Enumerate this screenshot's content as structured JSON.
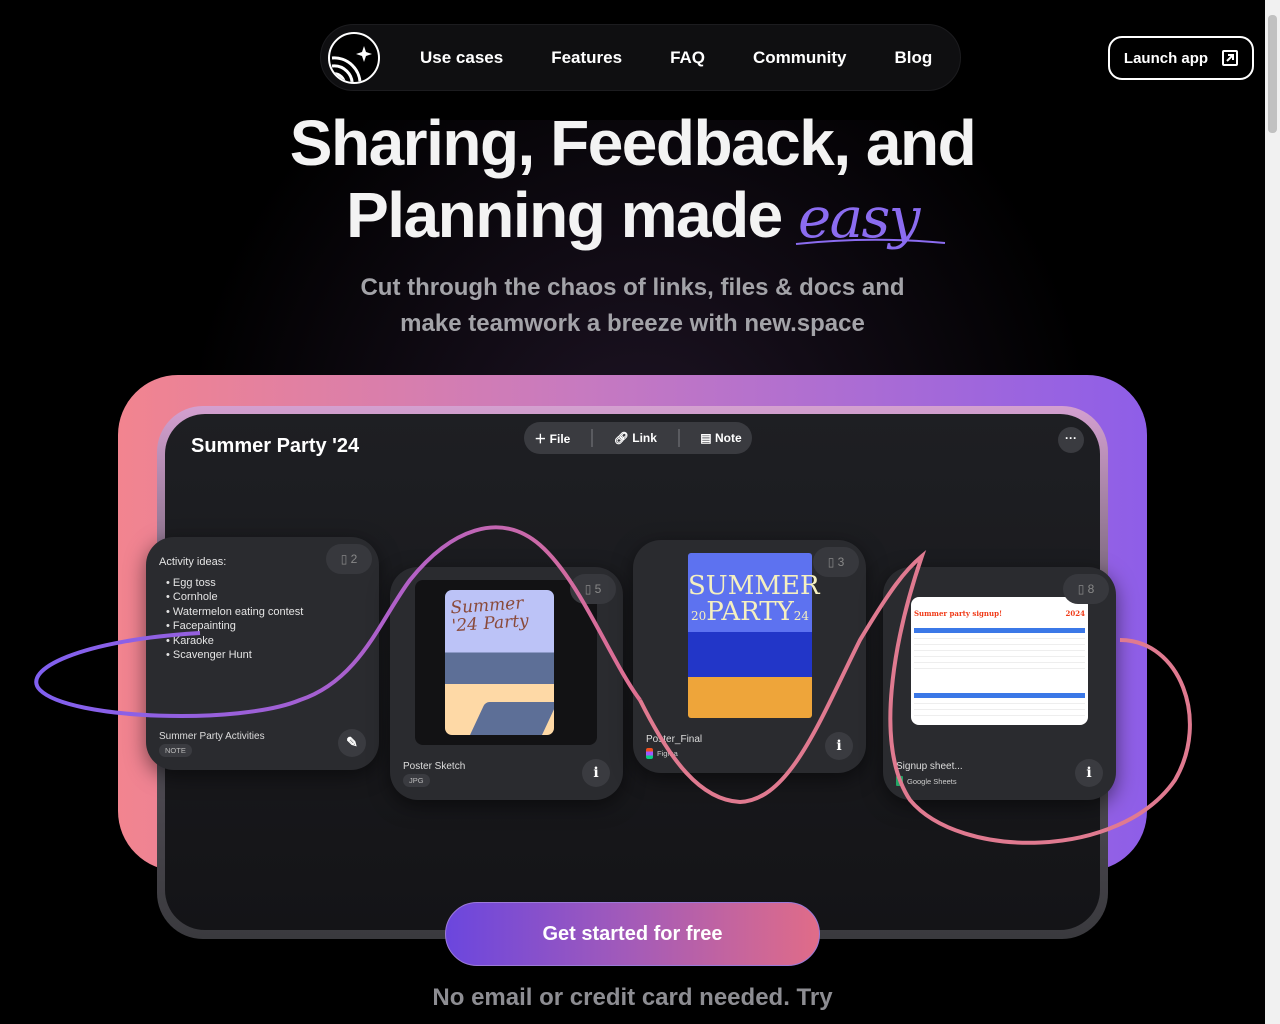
{
  "nav": {
    "items": [
      "Use cases",
      "Features",
      "FAQ",
      "Community",
      "Blog"
    ],
    "launch_label": "Launch app"
  },
  "hero": {
    "line1": "Sharing, Feedback, and",
    "line2": "Planning made ",
    "accent_word": "easy",
    "subtitle_line1": "Cut through the chaos of links, files & docs and",
    "subtitle_line2": "make teamwork a breeze with new.space"
  },
  "space": {
    "title": "Summer Party '24",
    "toolbar": {
      "file": "File",
      "link": "Link",
      "note": "Note"
    },
    "more_label": "···",
    "cards": [
      {
        "title": "Summer Party Activities",
        "tag": "NOTE",
        "count": "2",
        "note_heading": "Activity ideas:",
        "note_items": [
          "Egg toss",
          "Cornhole",
          "Watermelon eating contest",
          "Facepainting",
          "Karaoke",
          "Scavenger Hunt"
        ]
      },
      {
        "title": "Poster Sketch",
        "tag": "JPG",
        "count": "5",
        "poster_text": "Summer '24 Party"
      },
      {
        "title": "Poster_Final",
        "source": "Figma",
        "count": "3",
        "poster_line1": "SUMMER",
        "poster_line2": "PARTY",
        "year_left": "20",
        "year_right": "24"
      },
      {
        "title": "Signup sheet...",
        "source": "Google Sheets",
        "count": "8",
        "sheet_title": "Summer party signup!",
        "sheet_year": "2024"
      }
    ]
  },
  "cta": {
    "label": "Get started for free",
    "note": "No email or credit card needed. Try"
  },
  "colors": {
    "accent_purple": "#8b6cf0",
    "frame_pink": "#f2848f",
    "frame_purple": "#8e5ee8"
  }
}
